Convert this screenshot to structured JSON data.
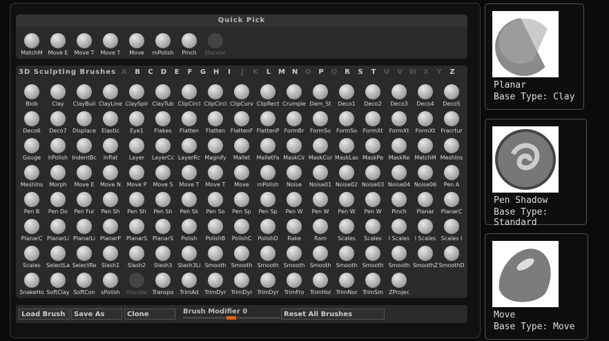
{
  "quick_pick": {
    "title": "Quick Pick",
    "items": [
      "MatchM",
      "Move E",
      "Move T",
      "Move T",
      "Move",
      "mPolish",
      "Pinch",
      "Standar"
    ],
    "dim": [
      false,
      false,
      false,
      false,
      false,
      false,
      false,
      true
    ]
  },
  "brushes": {
    "title": "3D Sculpting Brushes",
    "alphabet": [
      {
        "l": "A",
        "on": false
      },
      {
        "l": "B",
        "on": true
      },
      {
        "l": "C",
        "on": true
      },
      {
        "l": "D",
        "on": true
      },
      {
        "l": "E",
        "on": true
      },
      {
        "l": "F",
        "on": true
      },
      {
        "l": "G",
        "on": true
      },
      {
        "l": "H",
        "on": true
      },
      {
        "l": "I",
        "on": true
      },
      {
        "l": "J",
        "on": false
      },
      {
        "l": "K",
        "on": false
      },
      {
        "l": "L",
        "on": true
      },
      {
        "l": "M",
        "on": true
      },
      {
        "l": "N",
        "on": true
      },
      {
        "l": "O",
        "on": false
      },
      {
        "l": "P",
        "on": true
      },
      {
        "l": "Q",
        "on": false
      },
      {
        "l": "R",
        "on": true
      },
      {
        "l": "S",
        "on": true
      },
      {
        "l": "T",
        "on": true
      },
      {
        "l": "U",
        "on": false
      },
      {
        "l": "V",
        "on": false
      },
      {
        "l": "W",
        "on": false
      },
      {
        "l": "X",
        "on": false
      },
      {
        "l": "Y",
        "on": false
      },
      {
        "l": "Z",
        "on": true
      }
    ],
    "rows": [
      [
        "Blob",
        "Clay",
        "ClayBuil",
        "ClayLine",
        "ClaySpir",
        "ClayTub",
        "ClipCircl",
        "ClipCircl",
        "ClipCurv",
        "ClipRect",
        "Crumple",
        "Dam_St",
        "Deco1",
        "Deco2",
        "Deco3",
        "Deco4",
        "Deco5"
      ],
      [
        "Deco6",
        "Deco7",
        "Displace",
        "Elastic",
        "Eye1",
        "Flakes",
        "Flatten",
        "Flatten",
        "FlattenF",
        "FlattenP",
        "FormBr",
        "FormSo",
        "FormSo",
        "FormXt",
        "FormXt",
        "FormXt",
        "Fracrtur"
      ],
      [
        "Gouge",
        "hPolish",
        "IndentBc",
        "Inflat",
        "Layer",
        "LayerCc",
        "LayerRc",
        "Magnify",
        "Mallet",
        "MalletFa",
        "MaskCir",
        "MaskCur",
        "MaskLas",
        "MaskPe",
        "MaskRe",
        "MatchM",
        "MeshIns"
      ],
      [
        "MeshIns",
        "Morph",
        "Move E",
        "Move N",
        "Move P",
        "Move S",
        "Move T",
        "Move T",
        "Move",
        "mPolish",
        "Noise",
        "Noise01",
        "Noise02",
        "Noise03",
        "Noise04",
        "Noise06",
        "Pen A"
      ],
      [
        "Pen B",
        "Pen Do",
        "Pen Fur",
        "Pen Sh",
        "Pen Sh",
        "Pen Sh",
        "Pen Sk",
        "Pen So",
        "Pen Sp",
        "Pen Sp",
        "Pen W",
        "Pen W",
        "Pen W",
        "Pen W",
        "Pinch",
        "Planar",
        "PlanarC"
      ],
      [
        "PlanarC",
        "PlanarLi",
        "PlanarLi",
        "PlanarP",
        "PlanarS",
        "PlanarS",
        "Polish",
        "PolishB",
        "PolishC",
        "PolishD",
        "Rake",
        "Ram",
        "Scales",
        "Scales",
        "l Scales",
        "l Scales",
        "Scales l"
      ],
      [
        "Scales",
        "SelectLa",
        "SelectRe",
        "Slash1",
        "Slash2",
        "Slash3",
        "Slash3Li",
        "Smooth",
        "Smooth",
        "Smooth",
        "Smooth",
        "Smooth",
        "Smooth",
        "Smooth",
        "Smooth",
        "SmoothZ",
        "SmoothD"
      ],
      [
        "SnakeHo",
        "SoftClay",
        "SoftCon",
        "sPolish",
        "Standar",
        "Transpo",
        "TrimAd",
        "TrimDyr",
        "TrimDyr",
        "TrimDyr",
        "TrimFro",
        "TrimHol",
        "TrimNor",
        "TrimSm",
        "ZProjec"
      ]
    ],
    "dim": [
      "Standar"
    ]
  },
  "toolbar": {
    "load": "Load Brush",
    "save": "Save As",
    "clone": "Clone",
    "modifier_label": "Brush Modifier",
    "modifier_value": "0",
    "modifier_level": 0.5,
    "reset": "Reset All Brushes"
  },
  "side": [
    {
      "name": "Planar",
      "base": "Base Type: Clay",
      "icon": "planar-brush-icon"
    },
    {
      "name": "Pen Shadow",
      "base": "Base Type: Standard",
      "icon": "pen-shadow-brush-icon"
    },
    {
      "name": "Move",
      "base": "Base Type: Move",
      "icon": "move-brush-icon"
    }
  ],
  "colors": {
    "accent": "#e06010",
    "panel": "#2a2a2a",
    "bg": "#0b0b0b"
  }
}
